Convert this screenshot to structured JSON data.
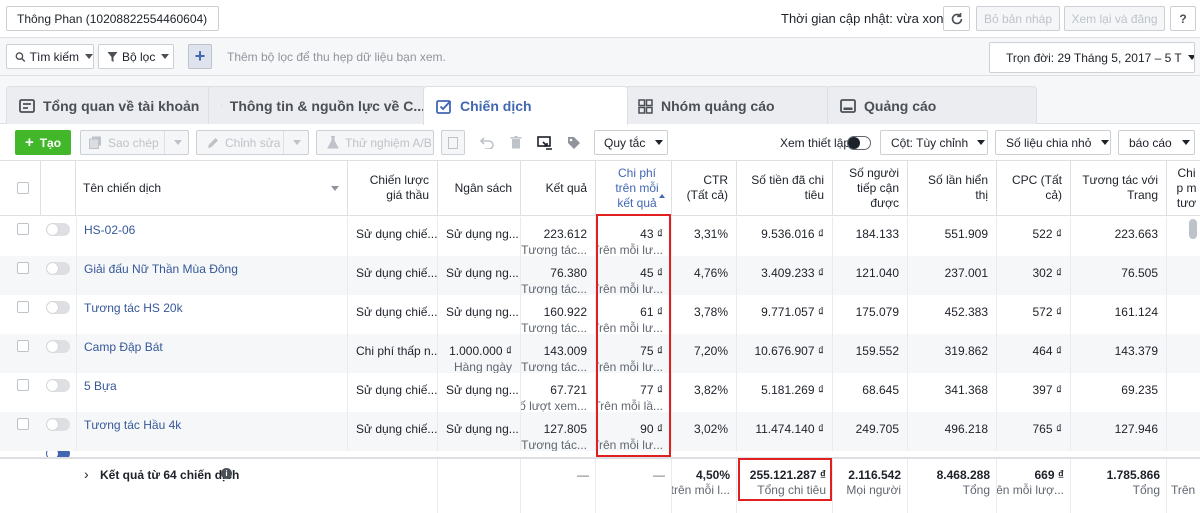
{
  "topbar": {
    "account": "Thông Phan (10208822554460604)",
    "update_time": "Thời gian cập nhật: vừa xong",
    "discard_draft": "Bỏ bản nháp",
    "review": "Xem lại và đăng"
  },
  "filterbar": {
    "search": "Tìm kiếm",
    "filter": "Bộ lọc",
    "hint": "Thêm bộ lọc để thu hẹp dữ liệu bạn xem.",
    "date_range": "Trọn đời: 29 Tháng 5, 2017 – 5 T"
  },
  "tabs": [
    {
      "label": "Tổng quan về tài khoản",
      "icon": "overview-icon"
    },
    {
      "label": "Thông tin & nguồn lực về C...",
      "icon": "heart-icon"
    },
    {
      "label": "Chiến dịch",
      "icon": "campaign-check-icon"
    },
    {
      "label": "Nhóm quảng cáo",
      "icon": "adset-grid-icon"
    },
    {
      "label": "Quảng cáo",
      "icon": "ad-icon"
    }
  ],
  "toolbar": {
    "create": "Tạo",
    "copy": "Sao chép",
    "edit": "Chỉnh sửa",
    "ab_test": "Thử nghiệm A/B",
    "rules": "Quy tắc",
    "view_setup": "Xem thiết lập",
    "columns": "Cột: Tùy chỉnh",
    "breakdown": "Số liệu chia nhỏ",
    "reports": "báo cáo"
  },
  "headers": {
    "name": "Tên chiến dịch",
    "bid": "Chiến lược giá thầu",
    "budget": "Ngân sách",
    "results": "Kết quả",
    "cpr": "Chi phí trên mỗi kết quả",
    "ctr": "CTR (Tất cả)",
    "spent": "Số tiền đã chi tiêu",
    "reach": "Số người tiếp cận được",
    "impr": "Số lần hiển thị",
    "cpc": "CPC (Tất cả)",
    "page_eng": "Tương tác với Trang",
    "cost_more": "Chi p m tươ"
  },
  "rows": [
    {
      "name": "HS-02-06",
      "bid": "Sử dụng chiế...",
      "budget": "Sử dụng ng...",
      "budget2": "",
      "results": "223.612",
      "results2": "Tương tác...",
      "cpr": "43 ₫",
      "cpr2": "Trên mỗi lư...",
      "ctr": "3,31%",
      "spent": "9.536.016 ₫",
      "reach": "184.133",
      "impr": "551.909",
      "cpc": "522 ₫",
      "eng": "223.663"
    },
    {
      "name": "Giải đấu Nữ Thần Mùa Đông",
      "bid": "Sử dụng chiế...",
      "budget": "Sử dụng ng...",
      "budget2": "",
      "results": "76.380",
      "results2": "Tương tác...",
      "cpr": "45 ₫",
      "cpr2": "Trên mỗi lư...",
      "ctr": "4,76%",
      "spent": "3.409.233 ₫",
      "reach": "121.040",
      "impr": "237.001",
      "cpc": "302 ₫",
      "eng": "76.505"
    },
    {
      "name": "Tương tác HS 20k",
      "bid": "Sử dụng chiế...",
      "budget": "Sử dụng ng...",
      "budget2": "",
      "results": "160.922",
      "results2": "Tương tác...",
      "cpr": "61 ₫",
      "cpr2": "Trên mỗi lư...",
      "ctr": "3,78%",
      "spent": "9.771.057 ₫",
      "reach": "175.079",
      "impr": "452.383",
      "cpc": "572 ₫",
      "eng": "161.124"
    },
    {
      "name": "Camp Đập Bát",
      "bid": "Chi phí thấp n...",
      "budget": "1.000.000 ₫",
      "budget2": "Hàng ngày",
      "results": "143.009",
      "results2": "Tương tác...",
      "cpr": "75 ₫",
      "cpr2": "Trên mỗi lư...",
      "ctr": "7,20%",
      "spent": "10.676.907 ₫",
      "reach": "159.552",
      "impr": "319.862",
      "cpc": "464 ₫",
      "eng": "143.379"
    },
    {
      "name": "5 Bựa",
      "bid": "Sử dụng chiế...",
      "budget": "Sử dụng ng...",
      "budget2": "",
      "results": "67.721",
      "results2": "Số lượt xem...",
      "cpr": "77 ₫",
      "cpr2": "Trên mỗi lầ...",
      "ctr": "3,82%",
      "spent": "5.181.269 ₫",
      "reach": "68.645",
      "impr": "341.368",
      "cpc": "397 ₫",
      "eng": "69.235"
    },
    {
      "name": "Tương tác Hầu 4k",
      "bid": "Sử dụng chiế...",
      "budget": "Sử dụng ng...",
      "budget2": "",
      "results": "127.805",
      "results2": "Tương tác...",
      "cpr": "90 ₫",
      "cpr2": "Trên mỗi lư...",
      "ctr": "3,02%",
      "spent": "11.474.140 ₫",
      "reach": "249.705",
      "impr": "496.218",
      "cpc": "765 ₫",
      "eng": "127.946"
    }
  ],
  "footer": {
    "label": "Kết quả từ 64 chiến dịch",
    "results": "—",
    "cpr": "—",
    "ctr": "4,50%",
    "ctr2": "trên mỗi l...",
    "spent": "255.121.287 ₫",
    "spent2": "Tổng chi tiêu",
    "reach": "2.116.542",
    "reach2": "Mọi người",
    "impr": "8.468.288",
    "impr2": "Tổng",
    "cpc": "669 ₫",
    "cpc2": "Trên mỗi lượ...",
    "eng": "1.785.866",
    "eng2": "Tổng",
    "more2": "Trên"
  },
  "colors": {
    "accent": "#4267b2",
    "create": "#42b72a",
    "highlight": "#e02020",
    "link": "#365899"
  }
}
